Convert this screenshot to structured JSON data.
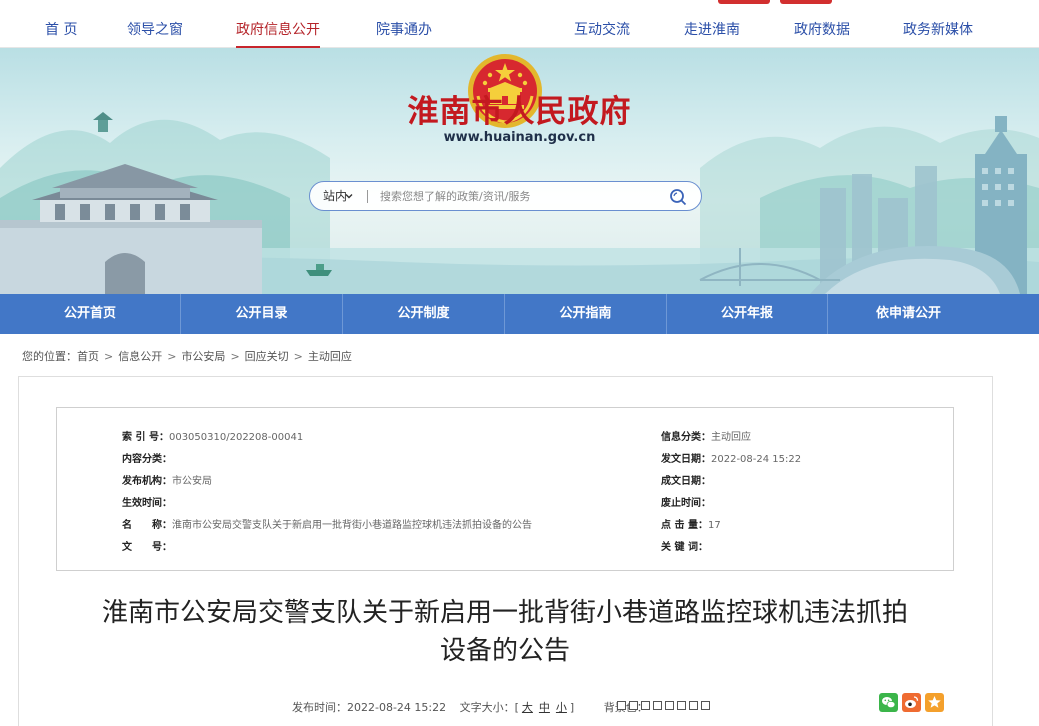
{
  "top_nav": {
    "items": [
      {
        "label": "首 页"
      },
      {
        "label": "领导之窗"
      },
      {
        "label": "政府信息公开",
        "active": true
      },
      {
        "label": "院事通办"
      },
      {
        "label": "互动交流"
      },
      {
        "label": "走进淮南"
      },
      {
        "label": "政府数据"
      },
      {
        "label": "政务新媒体"
      }
    ]
  },
  "banner": {
    "site_title": "淮南市人民政府",
    "site_domain": "www.huainan.gov.cn",
    "search": {
      "scope": "站内",
      "placeholder": "搜索您想了解的政策/资讯/服务",
      "value": ""
    }
  },
  "sub_nav": {
    "tabs": [
      {
        "label": "公开首页"
      },
      {
        "label": "公开目录"
      },
      {
        "label": "公开制度"
      },
      {
        "label": "公开指南"
      },
      {
        "label": "公开年报"
      },
      {
        "label": "依申请公开"
      }
    ]
  },
  "breadcrumb": {
    "prefix": "您的位置：",
    "items": [
      "首页",
      "信息公开",
      "市公安局",
      "回应关切",
      "主动回应"
    ]
  },
  "info": {
    "left": [
      {
        "label": "索 引 号：",
        "value": "003050310/202208-00041"
      },
      {
        "label": "内容分类：",
        "value": ""
      },
      {
        "label": "发布机构：",
        "value": "市公安局"
      },
      {
        "label": "生效时间：",
        "value": ""
      },
      {
        "label": "名　　称：",
        "value": "淮南市公安局交警支队关于新启用一批背街小巷道路监控球机违法抓拍设备的公告"
      },
      {
        "label": "文　　号：",
        "value": ""
      }
    ],
    "right": [
      {
        "label": "信息分类：",
        "value": "主动回应"
      },
      {
        "label": "发文日期：",
        "value": "2022-08-24 15:22"
      },
      {
        "label": "成文日期：",
        "value": ""
      },
      {
        "label": "废止时间：",
        "value": ""
      },
      {
        "label": "点 击 量：",
        "value": "17"
      },
      {
        "label": "关 键 词：",
        "value": ""
      }
    ]
  },
  "article": {
    "title_line1": "淮南市公安局交警支队关于新启用一批背街小巷道路监控球机违法抓拍",
    "title_line2": "设备的公告",
    "publish_label": "发布时间：",
    "publish_time": "2022-08-24 15:22",
    "font_size_label": "文字大小：[",
    "font_size_close": "]",
    "font_sizes": [
      "大",
      "中",
      "小"
    ],
    "bg_color_label": "背景色："
  },
  "colors": {
    "primary_blue": "#4277c7",
    "title_red": "#c3191f",
    "active_red": "#c8252c",
    "wechat_green": "#3bb54a",
    "weibo_orange": "#ef6b31",
    "favorite_orange": "#f4a02c"
  },
  "icons": {
    "emblem": "national-emblem-icon",
    "search": "search-icon",
    "share": [
      "wechat-icon",
      "weibo-icon",
      "favorite-star-icon"
    ]
  }
}
